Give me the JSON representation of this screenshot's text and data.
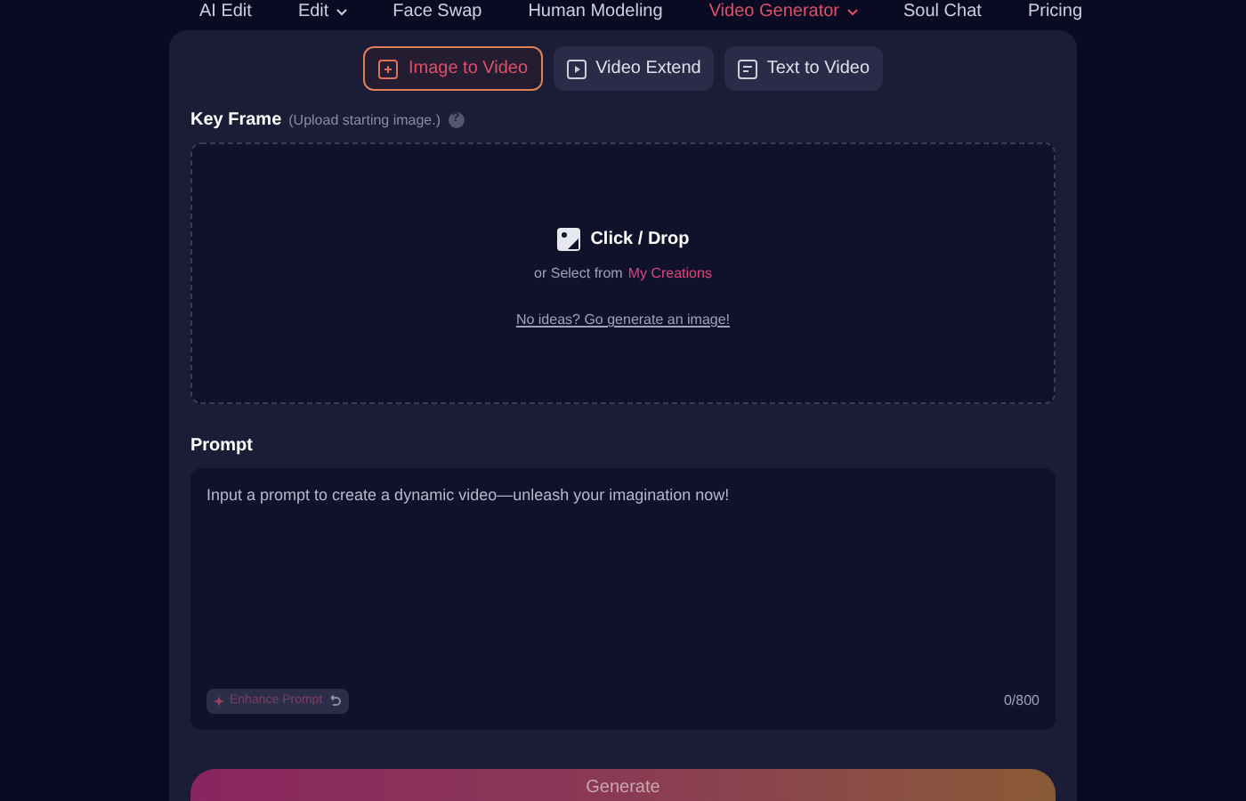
{
  "nav": [
    {
      "label": "AI Edit",
      "selected": false,
      "dropdown": false
    },
    {
      "label": "Edit",
      "selected": false,
      "dropdown": true
    },
    {
      "label": "Face Swap",
      "selected": false,
      "dropdown": false
    },
    {
      "label": "Human Modeling",
      "selected": false,
      "dropdown": false
    },
    {
      "label": "Video Generator",
      "selected": true,
      "dropdown": true
    },
    {
      "label": "Soul Chat",
      "selected": false,
      "dropdown": false
    },
    {
      "label": "Pricing",
      "selected": false,
      "dropdown": false
    }
  ],
  "tabs": [
    {
      "label": "Image to Video",
      "selected": true
    },
    {
      "label": "Video Extend",
      "selected": false
    },
    {
      "label": "Text to Video",
      "selected": false
    }
  ],
  "key_frame": {
    "label": "Key Frame",
    "hint": "(Upload starting image.)",
    "help": "?",
    "drop_label": "Click / Drop",
    "select_prefix": "or Select from",
    "select_link": "My Creations",
    "ideas_link": "No ideas? Go generate an image!"
  },
  "prompt": {
    "label": "Prompt",
    "placeholder": "Input a prompt to create a dynamic video—unleash your imagination now!",
    "enhance": "Enhance Prompt",
    "counter": "0/800"
  },
  "generate": "Generate"
}
